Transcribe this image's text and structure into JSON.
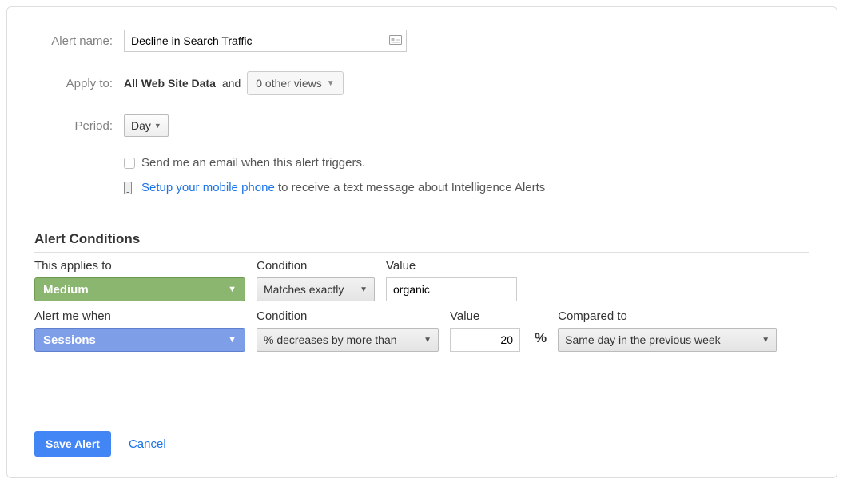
{
  "labels": {
    "alert_name": "Alert name:",
    "apply_to": "Apply to:",
    "period": "Period:",
    "and": "and"
  },
  "alert_name_value": "Decline in Search Traffic",
  "apply_to_view": "All Web Site Data",
  "other_views_label": "0 other views",
  "period_value": "Day",
  "email_checkbox_label": "Send me an email when this alert triggers.",
  "mobile_link": "Setup your mobile phone",
  "mobile_rest": " to receive a text message about Intelligence Alerts",
  "section_title": "Alert Conditions",
  "row1": {
    "applies_to_label": "This applies to",
    "applies_to_value": "Medium",
    "condition_label": "Condition",
    "condition_value": "Matches exactly",
    "value_label": "Value",
    "value_value": "organic"
  },
  "row2": {
    "alert_when_label": "Alert me when",
    "alert_when_value": "Sessions",
    "condition_label": "Condition",
    "condition_value": "% decreases by more than",
    "value_label": "Value",
    "value_value": "20",
    "compared_label": "Compared to",
    "compared_value": "Same day in the previous week"
  },
  "buttons": {
    "save": "Save Alert",
    "cancel": "Cancel"
  }
}
